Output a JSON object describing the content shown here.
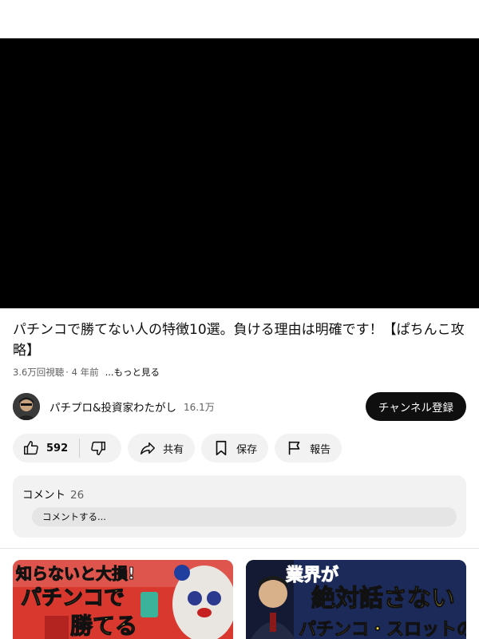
{
  "video": {
    "title": "パチンコで勝てない人の特徴10選。負ける理由は明確です！【ぱちんこ攻略】",
    "views": "3.6万回視聴",
    "age": "· 4 年前",
    "more_label": "...もっと見る"
  },
  "channel": {
    "name": "パチプロ&投資家わたがし",
    "subscribers": "16.1万",
    "subscribe_label": "チャンネル登録"
  },
  "actions": {
    "like_count": "592",
    "share_label": "共有",
    "save_label": "保存",
    "report_label": "報告"
  },
  "comments": {
    "header": "コメント",
    "count": "26",
    "placeholder": "コメントする..."
  },
  "recommendations": [
    {
      "thumbnail_text": "知らないと大損! パチンコで勝てる"
    },
    {
      "thumbnail_text": "業界が絶対話さない パチンコ・スロットの"
    }
  ],
  "colors": {
    "subscribe_bg": "#0f0f0f",
    "pill_bg": "#f2f2f2",
    "secondary_text": "#606060",
    "player_bg": "#000000"
  }
}
